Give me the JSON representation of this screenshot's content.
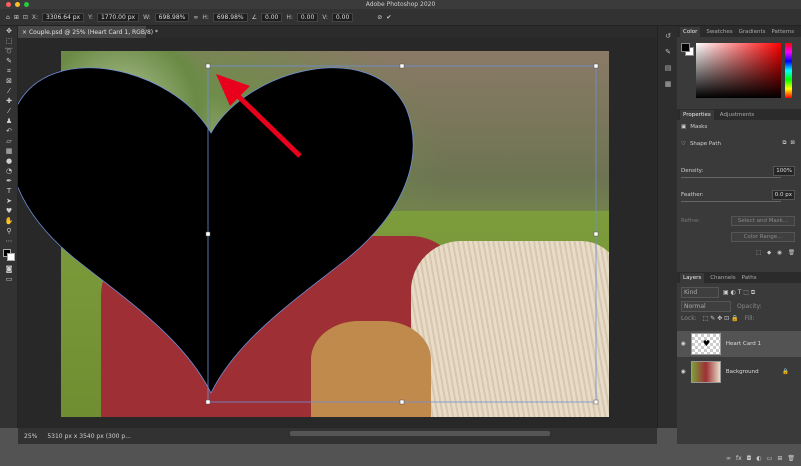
{
  "app": {
    "title": "Adobe Photoshop 2020"
  },
  "options_bar": {
    "x_label": "X:",
    "x_value": "3306.64 px",
    "y_label": "Y:",
    "y_value": "1770.00 px",
    "w_label": "W:",
    "w_value": "698.98%",
    "h_label": "H:",
    "h_value": "698.98%",
    "angle_value": "0.00",
    "h2_label": "H:",
    "h2_value": "0.00",
    "v_label": "V:",
    "v_value": "0.00"
  },
  "document_tab": {
    "label": "Couple.psd @ 25% (Heart Card 1, RGB/8) *"
  },
  "status_bar": {
    "zoom": "25%",
    "doc_info": "5310 px x 3540 px (300 p..."
  },
  "panels": {
    "color_tabs": [
      "Color",
      "Swatches",
      "Gradients",
      "Patterns"
    ],
    "properties_tabs": [
      "Properties",
      "Adjustments"
    ],
    "masks_label": "Masks",
    "shape_path_label": "Shape Path",
    "density_label": "Density:",
    "density_value": "100%",
    "feather_label": "Feather:",
    "feather_value": "0.0 px",
    "refine_label": "Refine:",
    "select_mask_label": "Select and Mask...",
    "color_range_label": "Color Range...",
    "layers_tabs": [
      "Layers",
      "Channels",
      "Paths"
    ],
    "kind_label": "Kind",
    "blend_mode": "Normal",
    "opacity_label": "Opacity:",
    "lock_label": "Lock:",
    "fill_label": "Fill:",
    "layers": [
      {
        "name": "Heart Card 1"
      },
      {
        "name": "Background"
      }
    ]
  },
  "colors": {
    "accent": "#e8001c",
    "heart": "#000000",
    "bbox": "#6f8fd8"
  }
}
